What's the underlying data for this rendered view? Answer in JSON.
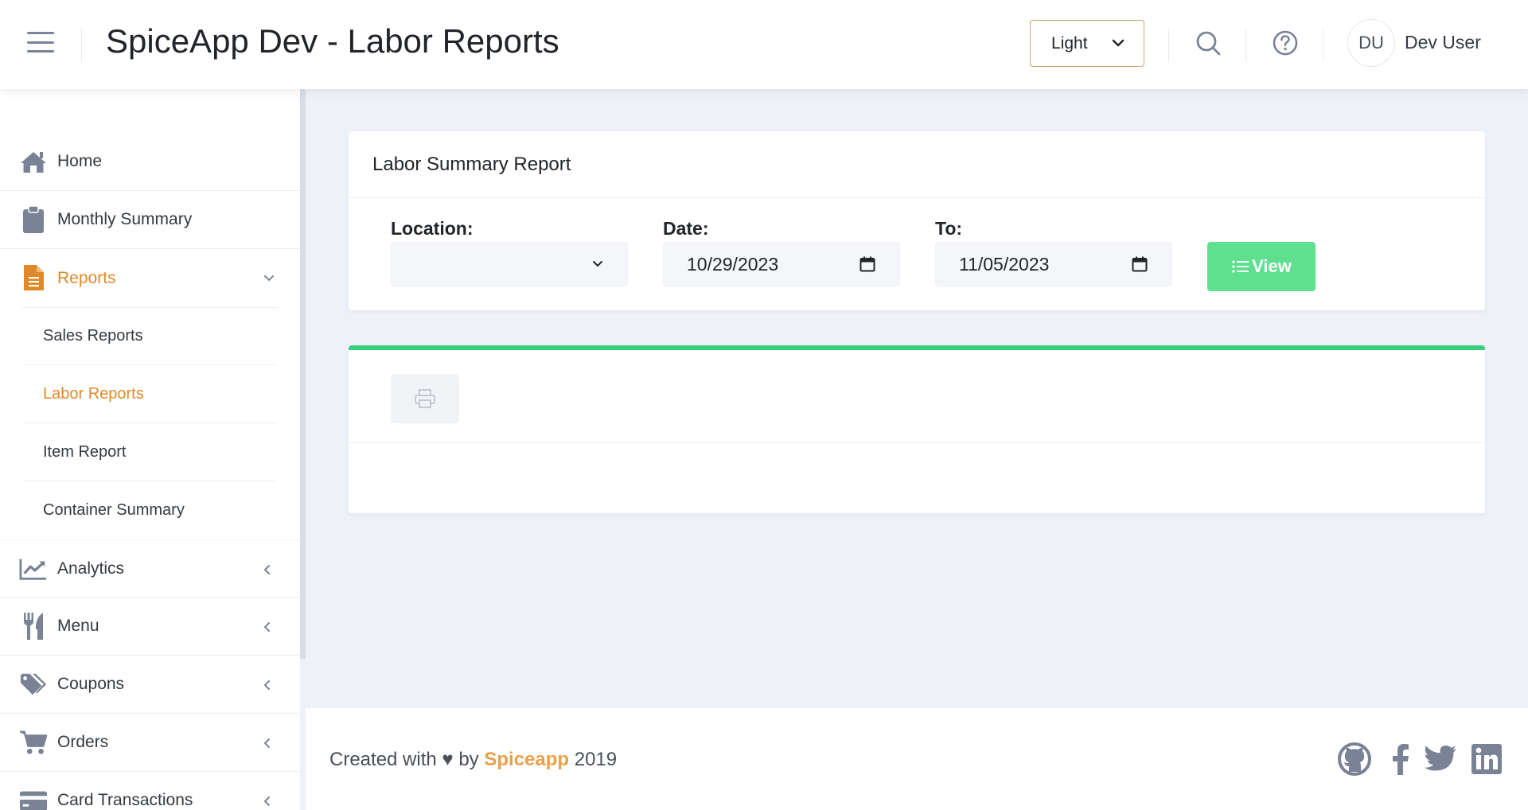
{
  "header": {
    "title": "SpiceApp Dev - Labor Reports",
    "theme_selected": "Light",
    "user_initials": "DU",
    "user_name": "Dev User"
  },
  "sidebar": {
    "items": [
      {
        "label": "Home",
        "icon": "home-icon"
      },
      {
        "label": "Monthly Summary",
        "icon": "clipboard-icon"
      },
      {
        "label": "Reports",
        "icon": "file-icon",
        "expanded": true,
        "active": true
      },
      {
        "label": "Analytics",
        "icon": "chart-line-icon"
      },
      {
        "label": "Menu",
        "icon": "utensils-icon"
      },
      {
        "label": "Coupons",
        "icon": "tags-icon"
      },
      {
        "label": "Orders",
        "icon": "cart-icon"
      },
      {
        "label": "Card Transactions",
        "icon": "credit-card-icon"
      }
    ],
    "reports_sub": [
      {
        "label": "Sales Reports"
      },
      {
        "label": "Labor Reports",
        "active": true
      },
      {
        "label": "Item Report"
      },
      {
        "label": "Container Summary"
      }
    ]
  },
  "report_card": {
    "title": "Labor Summary Report",
    "location_label": "Location:",
    "location_value": "",
    "date_label": "Date:",
    "date_value": "10/29/2023",
    "to_label": "To:",
    "to_value": "11/05/2023",
    "view_label": "View"
  },
  "footer": {
    "created_prefix": "Created with",
    "heart": "♥",
    "by": "by",
    "brand": "Spiceapp",
    "year": "2019"
  },
  "colors": {
    "accent": "#e0892a",
    "view_button": "#5fe08f",
    "card_top_border": "#3bcf7d",
    "icon_gray": "#7a8396"
  }
}
